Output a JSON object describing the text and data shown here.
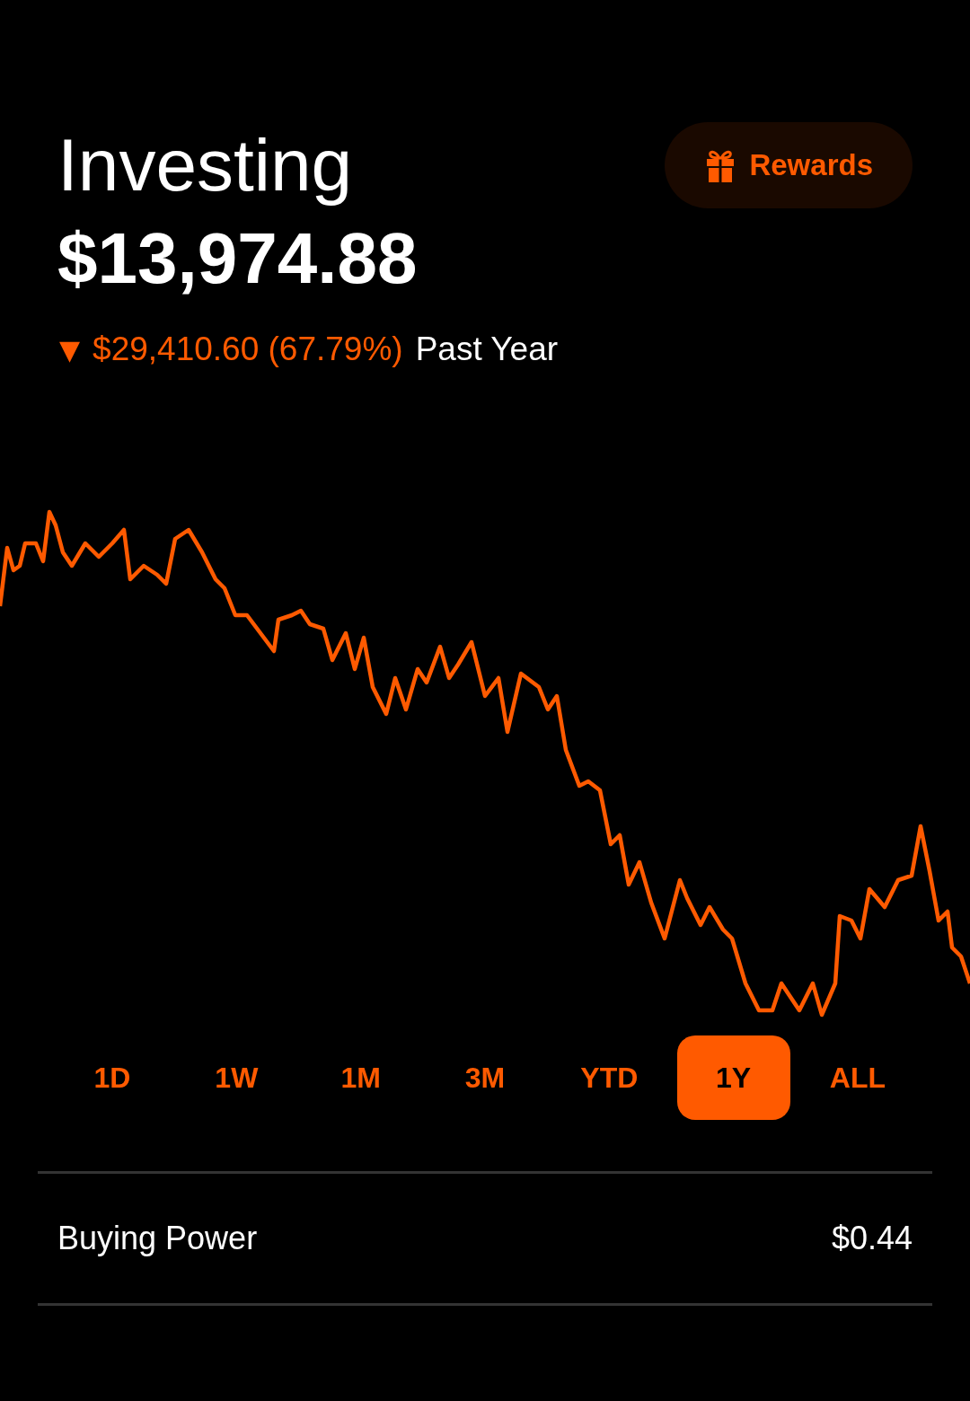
{
  "header": {
    "title": "Investing",
    "rewards_button": {
      "label": "Rewards"
    }
  },
  "balance": "$13,974.88",
  "change": {
    "arrow": "▼",
    "amount": "$29,410.60 (67.79%)",
    "period": "Past Year"
  },
  "ranges": [
    {
      "label": "1D",
      "selected": false
    },
    {
      "label": "1W",
      "selected": false
    },
    {
      "label": "1M",
      "selected": false
    },
    {
      "label": "3M",
      "selected": false
    },
    {
      "label": "YTD",
      "selected": false
    },
    {
      "label": "1Y",
      "selected": true
    },
    {
      "label": "ALL",
      "selected": false
    }
  ],
  "buying_power": {
    "label": "Buying Power",
    "value": "$0.44"
  }
}
